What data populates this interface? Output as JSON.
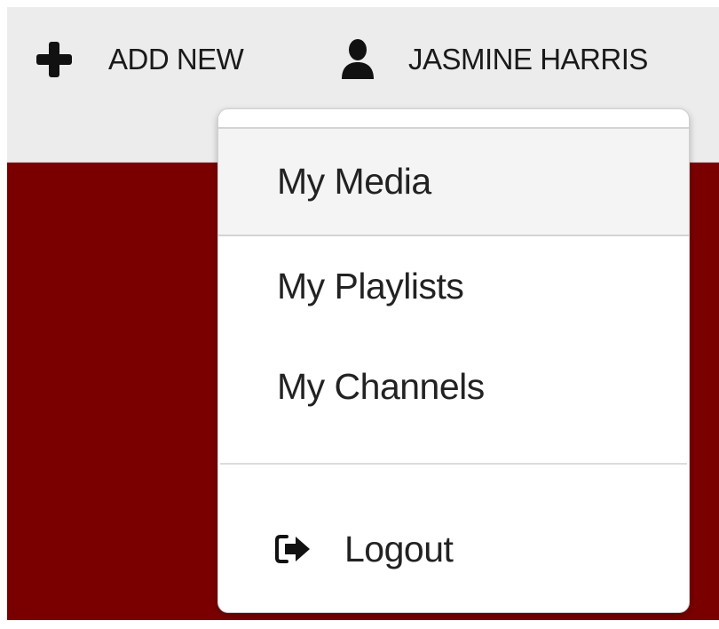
{
  "topbar": {
    "add_new_label": "ADD NEW",
    "add_new_icon": "plus-icon",
    "user_name": "JASMINE HARRIS",
    "user_icon": "user-icon"
  },
  "user_menu": {
    "items": [
      {
        "label": "My Media"
      },
      {
        "label": "My Playlists"
      },
      {
        "label": "My Channels"
      }
    ],
    "logout_label": "Logout",
    "logout_icon": "sign-out-icon"
  },
  "colors": {
    "topbar_background": "#ececec",
    "page_background": "#7a0000",
    "menu_background": "#ffffff",
    "menu_hover_background": "#f4f4f4"
  }
}
